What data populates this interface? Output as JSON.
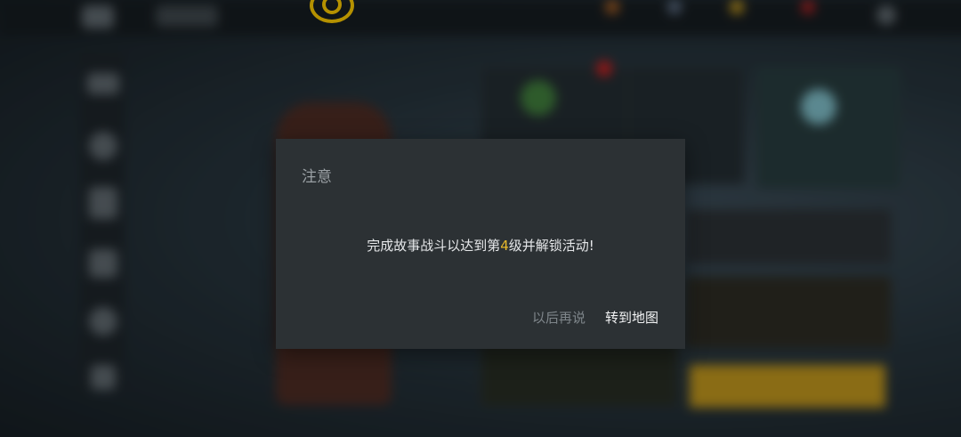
{
  "dialog": {
    "title": "注意",
    "message_prefix": "完成故事战斗以达到第",
    "message_level": "4",
    "message_suffix": "级并解锁活动!",
    "later_label": "以后再说",
    "goto_map_label": "转到地图"
  },
  "colors": {
    "dialog_bg": "#2c3134",
    "highlight": "#e8b92b",
    "brand_yellow": "#f2c200"
  },
  "icons": [
    "game-logo-icon"
  ]
}
